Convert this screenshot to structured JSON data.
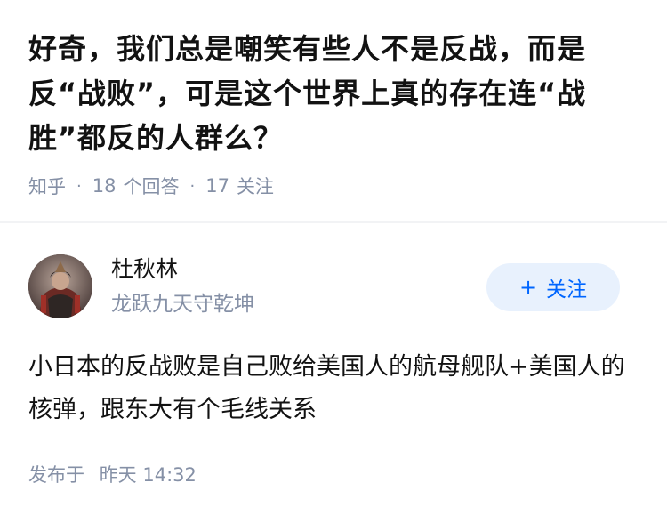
{
  "question": {
    "title": "好奇，我们总是嘲笑有些人不是反战，而是反“战败”，可是这个世界上真的存在连“战胜”都反的人群么？",
    "source": "知乎",
    "answers_count": "18",
    "answers_label": "个回答",
    "followers_count": "17",
    "followers_label": "关注"
  },
  "answer": {
    "author": {
      "name": "杜秋林",
      "headline": "龙跃九天守乾坤",
      "avatar_icon": "portrait-avatar"
    },
    "follow_button": {
      "icon": "plus-icon",
      "label": "关注"
    },
    "content": "小日本的反战败是自己败给美国人的航母舰队+美国人的核弹，跟东大有个毛线关系",
    "published_label": "发布于",
    "published_time": "昨天 14:32"
  },
  "colors": {
    "meta_gray": "#8590a6",
    "accent_blue": "#0066ff",
    "follow_bg": "#e8f1fd",
    "text": "#121212"
  }
}
